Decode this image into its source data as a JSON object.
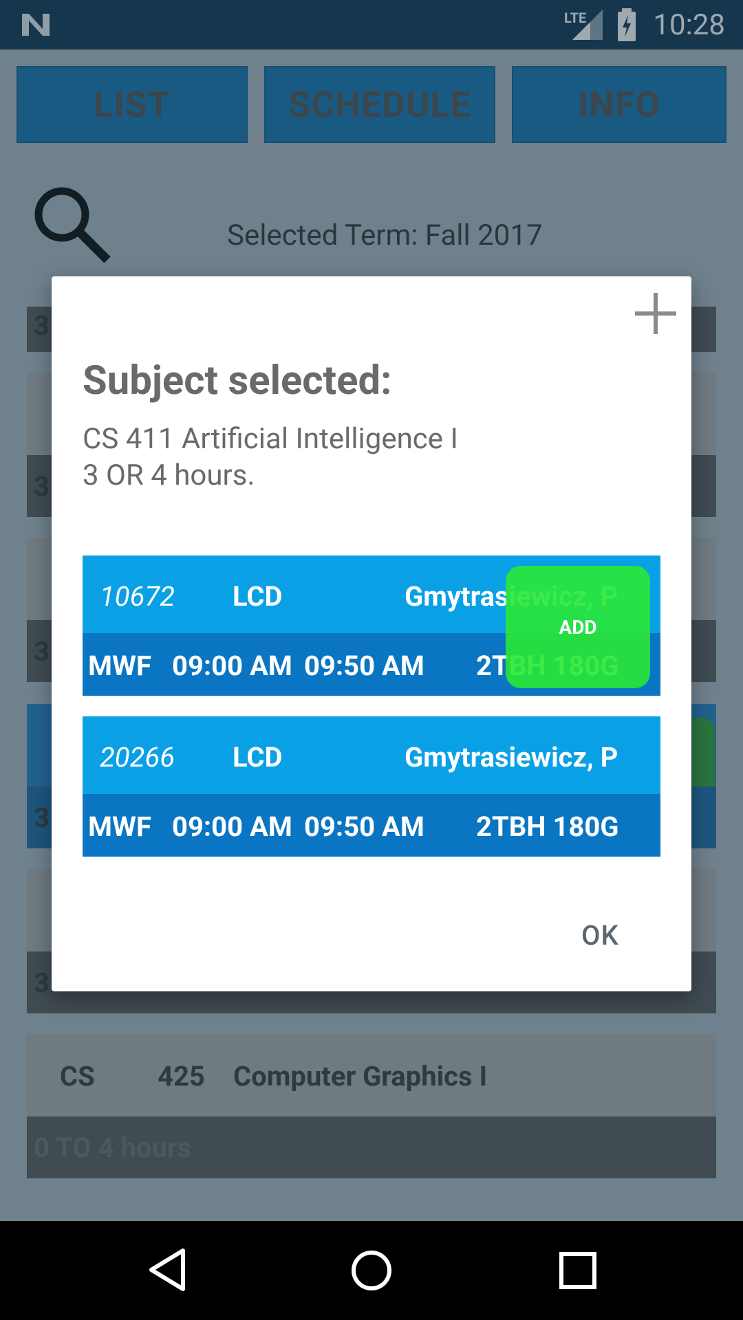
{
  "status": {
    "time": "10:28",
    "network": "LTE"
  },
  "tabs": [
    "LIST",
    "SCHEDULE",
    "INFO"
  ],
  "term_label": "Selected Term: Fall 2017",
  "background_list": {
    "visible_row": {
      "dept": "CS",
      "number": "425",
      "title": "Computer Graphics I",
      "hours": "0 TO 4 hours"
    },
    "partial_hours_prefix": "3"
  },
  "dialog": {
    "title": "Subject selected:",
    "subject_line": "CS 411 Artificial Intelligence I",
    "hours_line": "3 OR 4 hours.",
    "sections": [
      {
        "crn": "10672",
        "type": "LCD",
        "instructor": "Gmytrasiewicz, P",
        "days": "MWF",
        "start": "09:00 AM",
        "end": "09:50 AM",
        "room": "2TBH 180G"
      },
      {
        "crn": "20266",
        "type": "LCD",
        "instructor": "Gmytrasiewicz, P",
        "days": "MWF",
        "start": "09:00 AM",
        "end": "09:50 AM",
        "room": "2TBH 180G"
      }
    ],
    "add_label": "ADD",
    "ok_label": "OK"
  },
  "colors": {
    "status_bar": "#062e4b",
    "section_top": "#0aa0e6",
    "section_bottom": "#0a75c2",
    "add_green": "#29e835"
  }
}
